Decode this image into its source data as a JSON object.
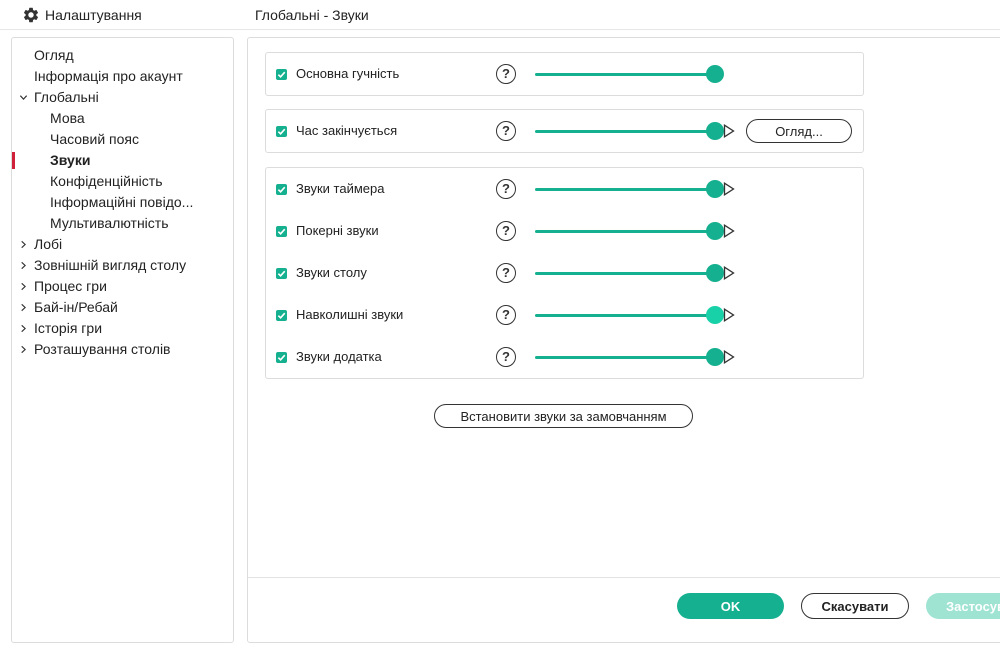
{
  "app": {
    "title": "Налаштування",
    "icon": "gear-icon"
  },
  "page_title": "Глобальні - Звуки",
  "colors": {
    "accent": "#15b08f",
    "accent_hover": "#19d1a8",
    "apply_disabled": "#9fe3d2",
    "active_marker": "#d0213b"
  },
  "sidebar": {
    "items": [
      {
        "label": "Огляд",
        "level": 0,
        "chevron": "none",
        "active": false
      },
      {
        "label": "Інформація про акаунт",
        "level": 0,
        "chevron": "none",
        "active": false
      },
      {
        "label": "Глобальні",
        "level": 0,
        "chevron": "down",
        "active": false
      },
      {
        "label": "Мова",
        "level": 1,
        "chevron": "none",
        "active": false
      },
      {
        "label": "Часовий пояс",
        "level": 1,
        "chevron": "none",
        "active": false
      },
      {
        "label": "Звуки",
        "level": 1,
        "chevron": "none",
        "active": true
      },
      {
        "label": "Конфіденційність",
        "level": 1,
        "chevron": "none",
        "active": false
      },
      {
        "label": "Інформаційні повідо...",
        "level": 1,
        "chevron": "none",
        "active": false
      },
      {
        "label": "Мультивалютність",
        "level": 1,
        "chevron": "none",
        "active": false
      },
      {
        "label": "Лобі",
        "level": 0,
        "chevron": "right",
        "active": false
      },
      {
        "label": "Зовнішній вигляд столу",
        "level": 0,
        "chevron": "right",
        "active": false
      },
      {
        "label": "Процес гри",
        "level": 0,
        "chevron": "right",
        "active": false
      },
      {
        "label": "Бай-ін/Ребай",
        "level": 0,
        "chevron": "right",
        "active": false
      },
      {
        "label": "Історія гри",
        "level": 0,
        "chevron": "right",
        "active": false
      },
      {
        "label": "Розташування столів",
        "level": 0,
        "chevron": "right",
        "active": false
      }
    ]
  },
  "main": {
    "master": {
      "label": "Основна гучність",
      "checked": true,
      "help": "?",
      "volume": 1.0
    },
    "timeout": {
      "label": "Час закінчується",
      "checked": true,
      "help": "?",
      "volume": 1.0,
      "play_icon": "play-icon",
      "browse_label": "Огляд..."
    },
    "sounds": [
      {
        "label": "Звуки таймера",
        "checked": true,
        "help": "?",
        "volume": 1.0
      },
      {
        "label": "Покерні звуки",
        "checked": true,
        "help": "?",
        "volume": 1.0
      },
      {
        "label": "Звуки столу",
        "checked": true,
        "help": "?",
        "volume": 1.0
      },
      {
        "label": "Навколишні звуки",
        "checked": true,
        "help": "?",
        "volume": 1.0,
        "hover": true
      },
      {
        "label": "Звуки додатка",
        "checked": true,
        "help": "?",
        "volume": 1.0
      }
    ],
    "defaults_button": "Встановити звуки за замовчанням"
  },
  "footer": {
    "ok": "OK",
    "cancel": "Скасувати",
    "apply": "Застосувати"
  }
}
